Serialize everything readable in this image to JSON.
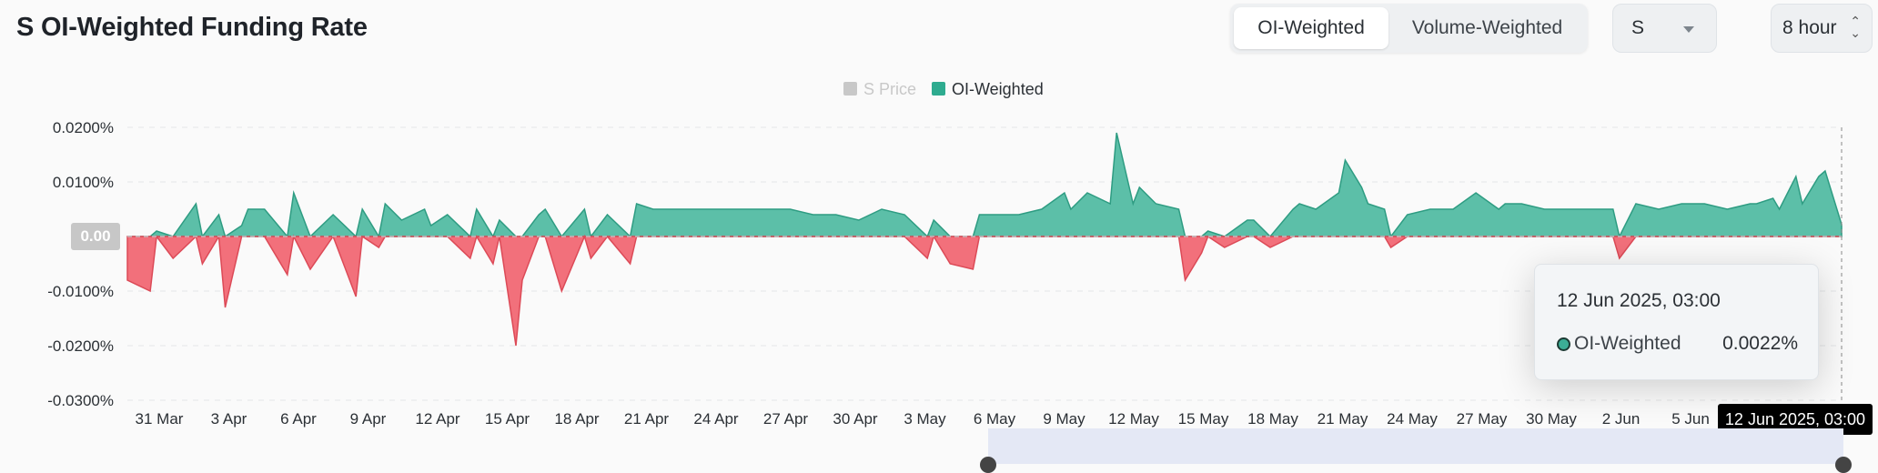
{
  "header": {
    "title": "S OI-Weighted Funding Rate",
    "tabs": [
      {
        "label": "OI-Weighted",
        "active": true
      },
      {
        "label": "Volume-Weighted",
        "active": false
      }
    ],
    "symbol_select": {
      "value": "S"
    },
    "interval_select": {
      "value": "8 hour"
    }
  },
  "colors": {
    "positive": "#5cbfa8",
    "positive_stroke": "#2e9c82",
    "negative": "#f2707b",
    "negative_stroke": "#dc4a57",
    "price": "#c8c8c8"
  },
  "tooltip": {
    "date": "12 Jun 2025, 03:00",
    "series": "OI-Weighted",
    "value": "0.0022%"
  },
  "pointer_label": "12 Jun 2025, 03:00",
  "zero_label": "0.00",
  "chart_data": {
    "type": "area",
    "title": "S OI-Weighted Funding Rate",
    "legend": {
      "position": "top-center",
      "items": [
        {
          "name": "S Price",
          "enabled": false
        },
        {
          "name": "OI-Weighted",
          "enabled": true
        }
      ]
    },
    "y_tick_labels": [
      "0.0200%",
      "0.0100%",
      "0.00",
      "-0.0100%",
      "-0.0200%",
      "-0.0300%"
    ],
    "y_ticks": [
      0.02,
      0.01,
      0,
      -0.01,
      -0.02,
      -0.03
    ],
    "ylim": [
      -0.03,
      0.02
    ],
    "y_unit": "%",
    "x_tick_labels": [
      "31 Mar",
      "3 Apr",
      "6 Apr",
      "9 Apr",
      "12 Apr",
      "15 Apr",
      "18 Apr",
      "21 Apr",
      "24 Apr",
      "27 Apr",
      "30 Apr",
      "3 May",
      "6 May",
      "9 May",
      "12 May",
      "15 May",
      "18 May",
      "21 May",
      "24 May",
      "27 May",
      "30 May",
      "2 Jun",
      "5 Jun"
    ],
    "grid": "horizontal-dashed",
    "series": [
      {
        "name": "OI-Weighted",
        "x": [
          "29 Mar",
          "30 Mar",
          "30 Mar",
          "31 Mar",
          "1 Apr",
          "1 Apr",
          "2 Apr",
          "2 Apr",
          "3 Apr",
          "3 Apr",
          "4 Apr",
          "5 Apr",
          "5 Apr",
          "6 Apr",
          "7 Apr",
          "8 Apr",
          "8 Apr",
          "9 Apr",
          "9 Apr",
          "10 Apr",
          "11 Apr",
          "11 Apr",
          "12 Apr",
          "13 Apr",
          "13 Apr",
          "14 Apr",
          "14 Apr",
          "15 Apr",
          "15 Apr",
          "16 Apr",
          "16 Apr",
          "17 Apr",
          "18 Apr",
          "18 Apr",
          "19 Apr",
          "20 Apr",
          "20 Apr",
          "21 Apr",
          "22 Apr",
          "23 Apr",
          "25 Apr",
          "27 Apr",
          "28 Apr",
          "29 Apr",
          "30 Apr",
          "1 May",
          "2 May",
          "3 May",
          "3 May",
          "4 May",
          "5 May",
          "5 May",
          "6 May",
          "7 May",
          "8 May",
          "9 May",
          "9 May",
          "10 May",
          "11 May",
          "11 May",
          "12 May",
          "12 May",
          "13 May",
          "14 May",
          "14 May",
          "15 May",
          "15 May",
          "16 May",
          "17 May",
          "17 May",
          "18 May",
          "19 May",
          "19 May",
          "20 May",
          "21 May",
          "21 May",
          "22 May",
          "22 May",
          "23 May",
          "23 May",
          "24 May",
          "25 May",
          "26 May",
          "27 May",
          "28 May",
          "28 May",
          "29 May",
          "30 May",
          "31 May",
          "1 Jun",
          "2 Jun",
          "2 Jun",
          "3 Jun",
          "4 Jun",
          "5 Jun",
          "6 Jun",
          "7 Jun",
          "8 Jun",
          "8 Jun",
          "9 Jun",
          "9 Jun",
          "10 Jun",
          "10 Jun",
          "11 Jun",
          "11 Jun",
          "12 Jun"
        ],
        "values": [
          -0.008,
          -0.01,
          0.001,
          -0.004,
          0.006,
          -0.005,
          0.004,
          -0.013,
          0.002,
          0.005,
          0.005,
          -0.007,
          0.008,
          -0.006,
          0.004,
          -0.011,
          0.005,
          -0.002,
          0.006,
          0.003,
          0.005,
          0.002,
          0.004,
          -0.004,
          0.005,
          -0.005,
          0.003,
          -0.02,
          -0.008,
          0.004,
          0.005,
          -0.01,
          0.005,
          -0.004,
          0.004,
          -0.005,
          0.006,
          0.005,
          0.005,
          0.005,
          0.005,
          0.005,
          0.004,
          0.004,
          0.003,
          0.005,
          0.004,
          -0.004,
          0.003,
          -0.005,
          -0.006,
          0.004,
          0.004,
          0.004,
          0.005,
          0.008,
          0.005,
          0.008,
          0.006,
          0.019,
          0.006,
          0.009,
          0.006,
          0.005,
          -0.008,
          -0.003,
          0.001,
          -0.002,
          0.003,
          0.003,
          -0.002,
          0.005,
          0.006,
          0.005,
          0.008,
          0.014,
          0.009,
          0.006,
          0.005,
          -0.002,
          0.004,
          0.005,
          0.005,
          0.008,
          0.005,
          0.006,
          0.006,
          0.005,
          0.005,
          0.005,
          0.005,
          -0.004,
          0.006,
          0.005,
          0.006,
          0.006,
          0.005,
          0.006,
          0.006,
          0.007,
          0.005,
          0.011,
          0.006,
          0.011,
          0.012,
          0.0022
        ]
      }
    ]
  }
}
